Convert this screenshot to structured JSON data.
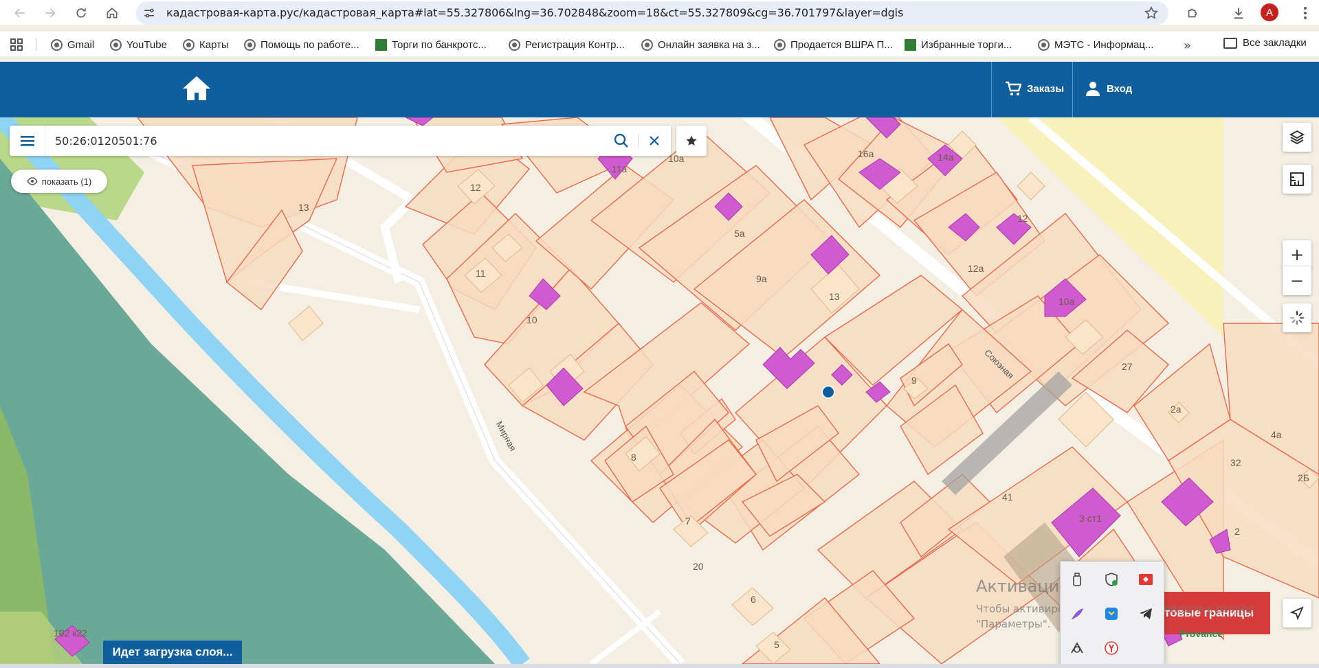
{
  "browser": {
    "url": "кадастровая-карта.рус/кадастровая_карта#lat=55.327806&lng=36.702848&zoom=18&ct=55.327809&cg=36.701797&layer=dgis",
    "profile_initial": "A",
    "bookmarks": [
      {
        "label": "Gmail"
      },
      {
        "label": "YouTube"
      },
      {
        "label": "Карты"
      },
      {
        "label": "Помощь по работе..."
      },
      {
        "label": "Торги по банкротс..."
      },
      {
        "label": "Регистрация Контр..."
      },
      {
        "label": "Онлайн заявка на з..."
      },
      {
        "label": "Продается ВШРА П..."
      },
      {
        "label": "Избранные торги..."
      },
      {
        "label": "МЭТС - Информац..."
      }
    ],
    "bookmarks_more": "»",
    "all_bookmarks": "Все закладки"
  },
  "header": {
    "orders_label": "Заказы",
    "login_label": "Вход",
    "color": "#0f5f9e"
  },
  "search": {
    "value": "50:26:0120501:76"
  },
  "show_button": "показать (1)",
  "map_controls": {
    "zoom_in": "+",
    "zoom_out": "−"
  },
  "map_labels": {
    "p13": "13",
    "p12": "12",
    "p11a": "11а",
    "p10a": "10а",
    "p11": "11",
    "p10": "10",
    "p5a": "5а",
    "p9a": "9а",
    "p16a": "16а",
    "p14a": "14а",
    "p12r": "12",
    "p12a": "12а",
    "p10ar": "10а",
    "p27": "27",
    "p9": "9",
    "p2a": "2а",
    "p4a": "4а",
    "p32": "32",
    "p2b": "2Б",
    "p41": "41",
    "p3st1": "3 ст1",
    "p2": "2",
    "p8": "8",
    "p7": "7",
    "p20": "20",
    "p6": "6",
    "p5": "5",
    "p102k22": "102 к22",
    "p13r": "13"
  },
  "streets": {
    "mirnaya": "Мирная",
    "soyuznaya": "Союзная"
  },
  "loading_text": "Идет загрузка слоя...",
  "red_button": "товые границы",
  "windows_watermark": {
    "title": "Активация Windows",
    "line1": "Чтобы активировать Windows, перейдите в раздел",
    "line2": "\"Параметры\"."
  },
  "provance": "Provance",
  "colors": {
    "parcel_fill": "#f7dcc1",
    "parcel_stroke": "#e8694c",
    "building": "#d05ad0",
    "river": "#8fd3f5",
    "forest": "#6aa898",
    "accent_red": "#d63c3c"
  }
}
